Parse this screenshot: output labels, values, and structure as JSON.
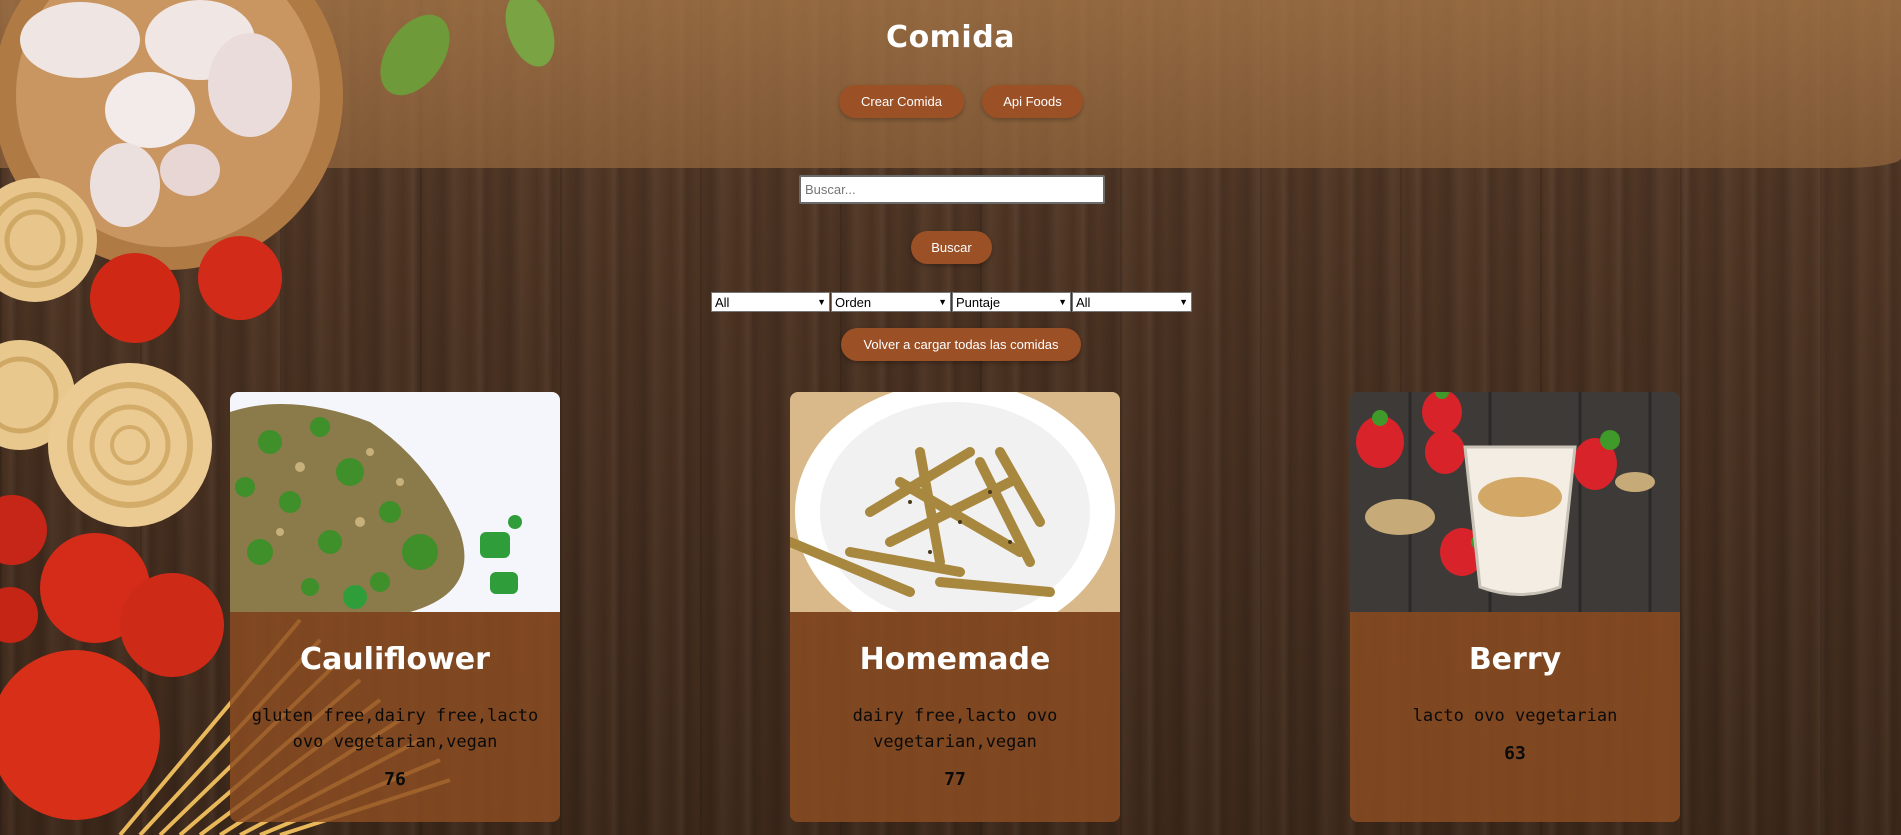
{
  "header": {
    "title": "Comida",
    "create_button": "Crear Comida",
    "api_button": "Api Foods"
  },
  "search": {
    "placeholder": "Buscar...",
    "value": "",
    "button": "Buscar"
  },
  "filters": {
    "diet": "All",
    "order": "Orden",
    "score": "Puntaje",
    "source": "All"
  },
  "reload_button": "Volver a cargar todas las comidas",
  "cards": [
    {
      "name": "Cauliflower",
      "diets": "gluten free,dairy free,lacto ovo vegetarian,vegan",
      "score": "76",
      "image": "fried-cauliflower-rice-image"
    },
    {
      "name": "Homemade",
      "diets": "dairy free,lacto ovo vegetarian,vegan",
      "score": "77",
      "image": "garden-fries-image"
    },
    {
      "name": "Berry",
      "diets": "lacto ovo vegetarian",
      "score": "63",
      "image": "berry-smoothie-image"
    }
  ],
  "colors": {
    "button": "#9c5026",
    "card": "#8e4e22",
    "band": "#a87848",
    "wood": "#4a3222"
  }
}
